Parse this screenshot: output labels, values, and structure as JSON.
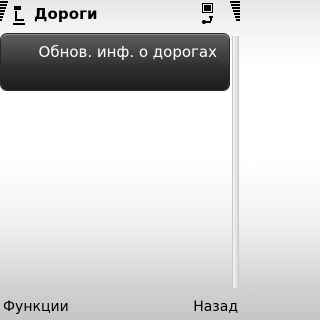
{
  "header": {
    "title": "Дороги",
    "app_icon": "traffic-info-icon",
    "status_icons": [
      "signal-strength-icon",
      "battery-icon",
      "connection-icon",
      "battery-level-icon"
    ]
  },
  "list": {
    "items": [
      {
        "label": "Обнов. инф. о дорогах",
        "selected": true
      }
    ]
  },
  "softkeys": {
    "left_label": "Функции",
    "right_label": "Назад"
  },
  "colors": {
    "highlight": "#2e2e2e",
    "highlight_text": "#ffffff",
    "text": "#000000"
  }
}
